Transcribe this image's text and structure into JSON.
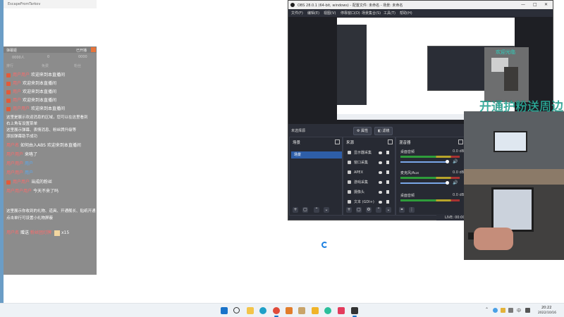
{
  "danmu_window": {
    "title": "EscapeFromTarkov",
    "header_title": "弹幕姬",
    "header_right": "已开播",
    "stats": [
      "0000人",
      "0",
      "0000"
    ],
    "tabs": [
      "排行",
      "免费",
      "粉丝"
    ],
    "welcome_lines": [
      {
        "user": "用户用户",
        "text": "欢迎来到本直播间"
      },
      {
        "user": "用户",
        "text": "欢迎来到本直播间"
      },
      {
        "user": "用户",
        "text": "欢迎来到本直播间"
      },
      {
        "user": "用户",
        "text": "欢迎来到本直播间"
      },
      {
        "user": "用户用户",
        "text": "欢迎来到本直播间"
      }
    ],
    "info_lines": [
      "这里是展示欢迎消息的区域，您可以在这里看到",
      "右上角有设置菜单",
      "这里展示弹幕、表情消息、粉丝牌升级等",
      "添加弹幕助手成功"
    ],
    "chat_lines": [
      {
        "user": "用户名",
        "text": "如何由入ABS 欢迎来到本直播间"
      },
      {
        "user": "用户用户",
        "text": "来咯了"
      },
      {
        "user": "用户用户",
        "text": "用户"
      },
      {
        "user": "用户用户",
        "text": "用户"
      },
      {
        "user": "用户用户",
        "text": "当成的粉丝"
      },
      {
        "user": "用户用户用户",
        "text": "今天不来了吗"
      }
    ],
    "footer_lines": [
      "这里展示你收到的礼物、道具、开通舰长、贴纸开通",
      "点击单行可设置小礼物屏蔽"
    ],
    "gift_line": {
      "user": "用户名",
      "action": "赠送",
      "gift": "粉丝团灯牌",
      "count": "x15"
    }
  },
  "obs": {
    "title": "OBS 28.0.1 (64-bit, windows) - 配置文件: 未命名 - 场景: 未命名",
    "window_controls": [
      "—",
      "□",
      "✕"
    ],
    "menu": [
      "文件(F)",
      "编辑(E)",
      "视图(V)",
      "停靠窗口(D)",
      "场景集合(S)",
      "工具(T)",
      "帮助(H)"
    ],
    "scene_label": "未选择源",
    "buttons": {
      "properties": "属性",
      "filters": "滤镜"
    },
    "docks": {
      "scenes": "场景",
      "sources": "来源",
      "mixer": "混音器"
    },
    "scenes": [
      "场景"
    ],
    "sources": [
      "显示器采集",
      "窗口采集",
      "APEX",
      "游戏采集",
      "摄像头",
      "文本 (GDI+)"
    ],
    "mixer": [
      {
        "name": "桌面音频",
        "db": "0.0 dB"
      },
      {
        "name": "麦克风/Aux",
        "db": "0.0 dB"
      },
      {
        "name": "桌面音频",
        "db": "0.0 dB"
      }
    ],
    "status": "LIVE: 00:00:00"
  },
  "overlay": {
    "big_text": "开通护粉送周边",
    "small_text": "欢迎光临"
  },
  "taskbar": {
    "ime": "中",
    "time": "20:22",
    "date": "2022/10/16"
  },
  "icons": {
    "start": "windows-start-icon",
    "search": "search-icon",
    "files": "file-explorer-icon",
    "edge": "edge-browser-icon",
    "chrome": "chrome-icon",
    "accent": "#1a73c9"
  }
}
